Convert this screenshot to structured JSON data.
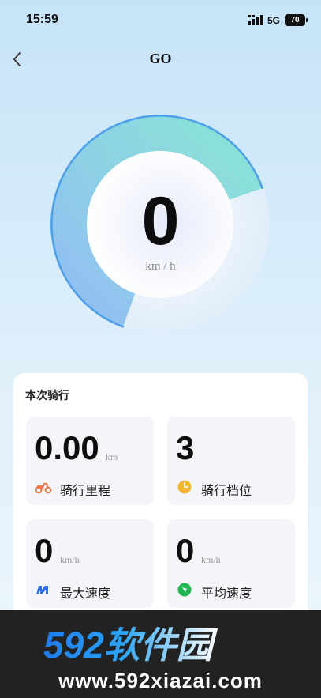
{
  "status_bar": {
    "time": "15:59",
    "network": "5G",
    "battery": "70"
  },
  "nav": {
    "title": "GO",
    "back_icon": "chevron-left-icon"
  },
  "speedometer": {
    "value": "0",
    "unit": "km / h",
    "arc_level": 0.64,
    "accent_start": "#8ab4f5",
    "accent_end": "#7ee7cf"
  },
  "ride": {
    "title": "本次骑行",
    "items": [
      {
        "value": "0.00",
        "unit": "km",
        "label": "骑行里程",
        "icon": "scooter-icon",
        "icon_color": "#f07a4c"
      },
      {
        "value": "3",
        "unit": "",
        "label": "骑行档位",
        "icon": "clock-icon",
        "icon_color": "#f3b62c"
      },
      {
        "value": "0",
        "unit": "km/h",
        "label": "最大速度",
        "icon": "brand-m-icon",
        "icon_color": "#2f6ee5"
      },
      {
        "value": "0",
        "unit": "km/h",
        "label": "平均速度",
        "icon": "compass-icon",
        "icon_color": "#22b551"
      }
    ]
  },
  "watermark": {
    "logo_text": "592软件园",
    "url": "www.592xiazai.com"
  }
}
